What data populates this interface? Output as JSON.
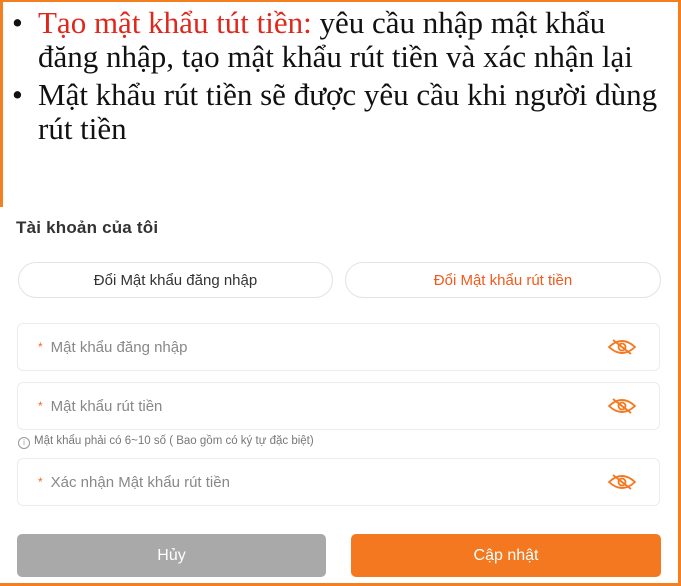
{
  "slide_notes": {
    "bullet1_highlight": "Tạo mật khẩu tút tiền:",
    "bullet1_rest": " yêu cầu nhập mật khẩu đăng nhập, tạo mật khẩu rút tiền và xác nhận lại",
    "bullet2": "Mật khẩu rút tiền sẽ được yêu cầu khi người dùng rút tiền"
  },
  "account": {
    "title": "Tài khoản của tôi",
    "tabs": {
      "login_password": "Đổi Mật khẩu đăng nhập",
      "withdraw_password": "Đổi Mật khẩu rút tiền"
    },
    "fields": {
      "login_password_placeholder": "Mật khẩu đăng nhập",
      "withdraw_password_placeholder": "Mật khẩu rút tiền",
      "confirm_password_placeholder": "Xác nhận Mật khẩu rút tiền"
    },
    "hint": "Mật khẩu phải có 6~10 số ( Bao gồm có ký tự đặc biệt)",
    "buttons": {
      "cancel": "Hủy",
      "update": "Cập nhật"
    }
  },
  "icons": {
    "password_toggle": "eye-slash-icon",
    "hint": "info-icon"
  },
  "colors": {
    "accent": "#f47820",
    "highlight_text": "#e0271c",
    "cancel": "#a9a9a9"
  }
}
